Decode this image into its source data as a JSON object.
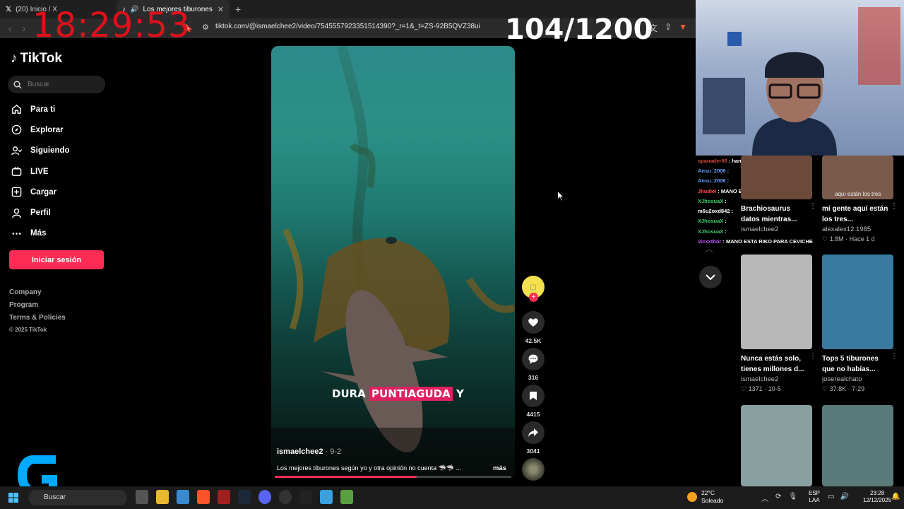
{
  "browser": {
    "tabs": [
      {
        "label": "(20) Inicio / X",
        "icon": "x-logo-icon"
      },
      {
        "label": "Los mejores tiburones según",
        "icon": "tiktok-icon"
      }
    ],
    "new_tab_label": "+",
    "url": "tiktok.com/@ismaelchee2/video/7545557923351514390?_r=1&_t=ZS-92B5QVZ38ui"
  },
  "overlay": {
    "clock": "18:29:53",
    "counter": "104/1200"
  },
  "tiktok": {
    "logo": "TikTok",
    "search_placeholder": "Buscar",
    "nav": [
      {
        "label": "Para ti",
        "icon": "home-icon"
      },
      {
        "label": "Explorar",
        "icon": "compass-icon"
      },
      {
        "label": "Siguiendo",
        "icon": "following-icon"
      },
      {
        "label": "LIVE",
        "icon": "live-icon"
      },
      {
        "label": "Cargar",
        "icon": "upload-icon"
      },
      {
        "label": "Perfil",
        "icon": "profile-icon"
      },
      {
        "label": "Más",
        "icon": "more-icon"
      }
    ],
    "login_label": "Iniciar sesión",
    "footer": [
      "Company",
      "Program",
      "Terms & Policies"
    ],
    "copyright": "© 2025 TikTok",
    "accent": "#fe2c55"
  },
  "video": {
    "caption_word1": "DURA",
    "caption_highlight": "PUNTIAGUDA",
    "caption_word3": "Y",
    "author": "ismaelchee2",
    "date": "· 9-2",
    "description": "Los mejores tiburones según yo y otra opinión no cuenta 🦈🦈 ...",
    "more_label": "más",
    "progress_fraction": 0.6,
    "likes": "42.5K",
    "comments": "316",
    "saves": "4415",
    "shares": "3041"
  },
  "chat": [
    {
      "user": "spanader08",
      "color": "#d04a3a",
      "text": ": han actualizado el server mano"
    },
    {
      "user": "Ansu_2006",
      "color": "#6aa0ff",
      "text": ":"
    },
    {
      "user": "Ansu_2006",
      "color": "#6aa0ff",
      "text": ":"
    },
    {
      "user": "Jhudiel",
      "color": "#ff4d4d",
      "text": ": MANO ESTABA RIKO"
    },
    {
      "user": "XJhosuaX",
      "color": "#3cd070",
      "text": ":"
    },
    {
      "user": "m6u2oxd842",
      "color": "#fff",
      "text": ":"
    },
    {
      "user": "XJhosuaX",
      "color": "#3cd070",
      "text": ":"
    },
    {
      "user": "XJhosuaX",
      "color": "#3cd070",
      "text": ":"
    },
    {
      "user": "vicxxthor",
      "color": "#c050ff",
      "text": ": MANO ESTA RIKO PARA CEVICHE"
    }
  ],
  "recommendations": [
    {
      "title": "Brachiosaurus datos mientras...",
      "author": "ismaelchee2",
      "stats": "",
      "thumb_color": "#6b4a3a"
    },
    {
      "title": "mi gente aquí están los tres...",
      "author": "alexalex12.1985",
      "stats": "♡ 1.8M · Hace 1 d",
      "thumb_color": "#7a5a4a",
      "overlay": "aquí están los tres"
    },
    {
      "title": "Nunca estás solo, tienes millones d...",
      "author": "ismaelchee2",
      "stats": "♡ 1371 · 10-5",
      "thumb_color": "#b8b8b8"
    },
    {
      "title": "Tops 5 tiburones que no habías...",
      "author": "joserealchato",
      "stats": "♡ 37.8K · 7-29",
      "thumb_color": "#3a7aa0"
    },
    {
      "title": "",
      "author": "",
      "stats": "",
      "thumb_color": "#8aa0a0"
    },
    {
      "title": "",
      "author": "",
      "stats": "",
      "thumb_color": "#5a7a7a"
    }
  ],
  "taskbar": {
    "search": "Buscar",
    "weather_temp": "22°C",
    "weather_text": "Soleado",
    "lang_top": "ESP",
    "lang_bottom": "LAA",
    "time": "23:28",
    "date": "12/12/2025"
  }
}
